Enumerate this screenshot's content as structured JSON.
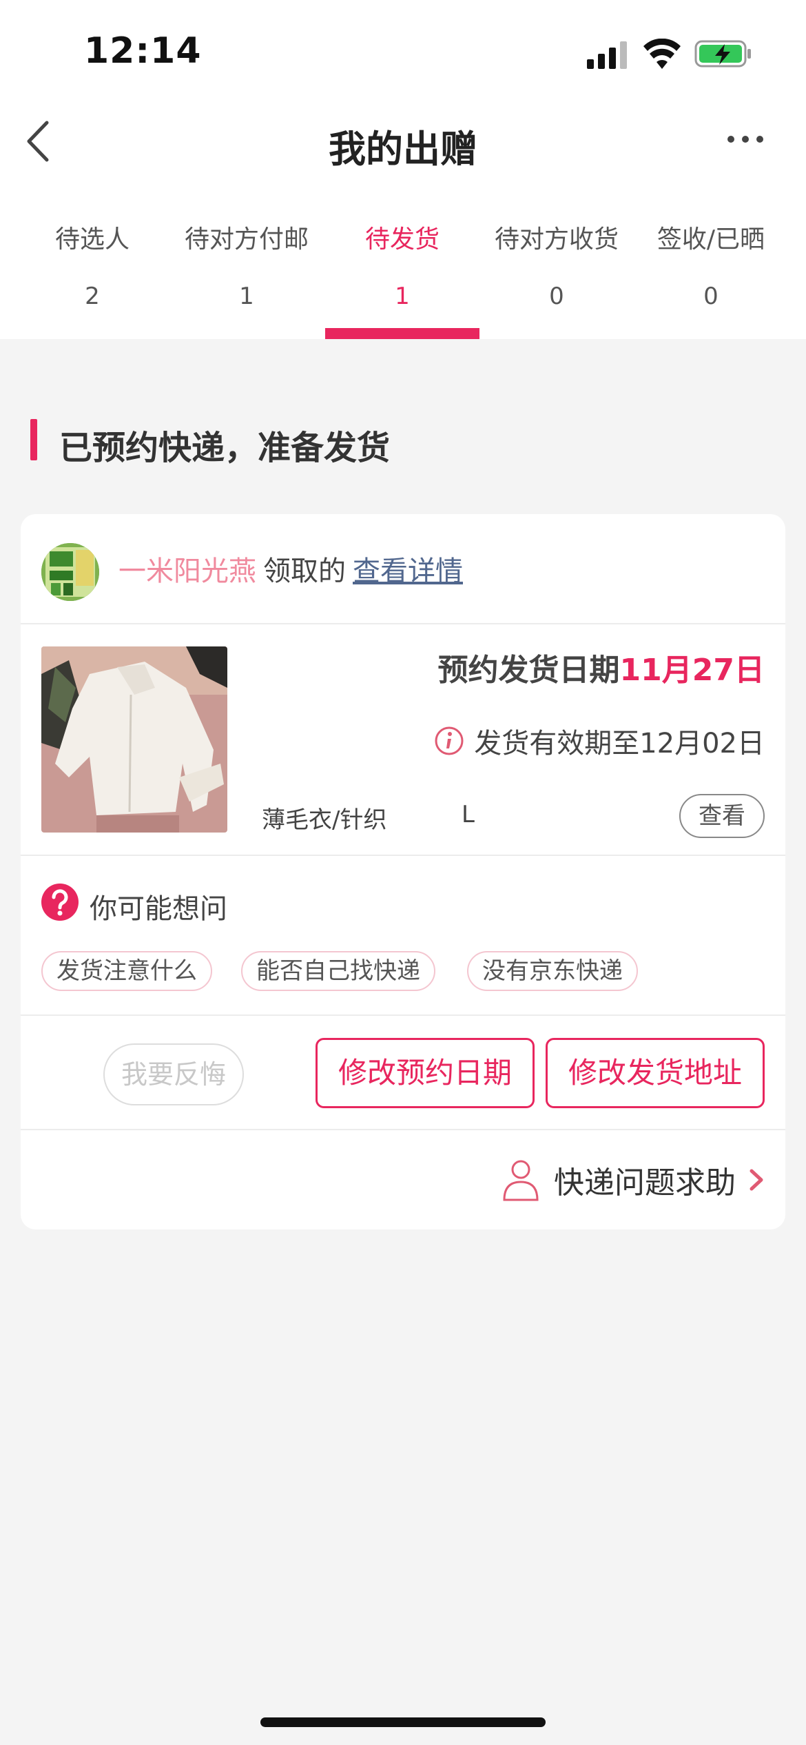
{
  "status_bar": {
    "time": "12:14"
  },
  "nav": {
    "title": "我的出赠"
  },
  "tabs": [
    {
      "label": "待选人",
      "count": "2"
    },
    {
      "label": "待对方付邮",
      "count": "1"
    },
    {
      "label": "待发货",
      "count": "1"
    },
    {
      "label": "待对方收货",
      "count": "0"
    },
    {
      "label": "签收/已晒",
      "count": "0"
    }
  ],
  "active_tab": "待发货",
  "section": {
    "title": "已预约快递，准备发货"
  },
  "card": {
    "username": "一米阳光燕",
    "claimed_text": "领取的",
    "detail_link": "查看详情",
    "ship_date_label": "预约发货日期",
    "ship_date_value": "11月27日",
    "valid_until": "发货有效期至12月02日",
    "item_name": "薄毛衣/针织",
    "item_size": "L",
    "view_button": "查看",
    "faq_title": "你可能想问",
    "faq_chips": [
      "发货注意什么",
      "能否自己找快递",
      "没有京东快递"
    ],
    "regret_button": "我要反悔",
    "change_date_button": "修改预约日期",
    "change_address_button": "修改发货地址",
    "help_text": "快递问题求助"
  },
  "colors": {
    "accent": "#e8265e",
    "username": "#f08a9e",
    "link": "#51678e"
  }
}
